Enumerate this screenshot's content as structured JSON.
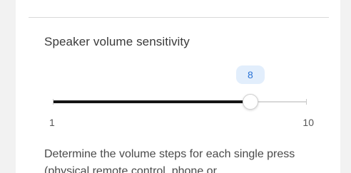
{
  "setting": {
    "title": "Speaker volume sensitivity",
    "description": "Determine the volume steps for each single press (physical remote control, phone or"
  },
  "slider": {
    "min": 1,
    "max": 10,
    "value": 8,
    "min_label": "1",
    "max_label": "10",
    "value_label": "8"
  },
  "colors": {
    "fill": "#151515",
    "track": "#d8d8d8",
    "bubble_bg": "#e2eefc",
    "bubble_text": "#2a73d6"
  }
}
